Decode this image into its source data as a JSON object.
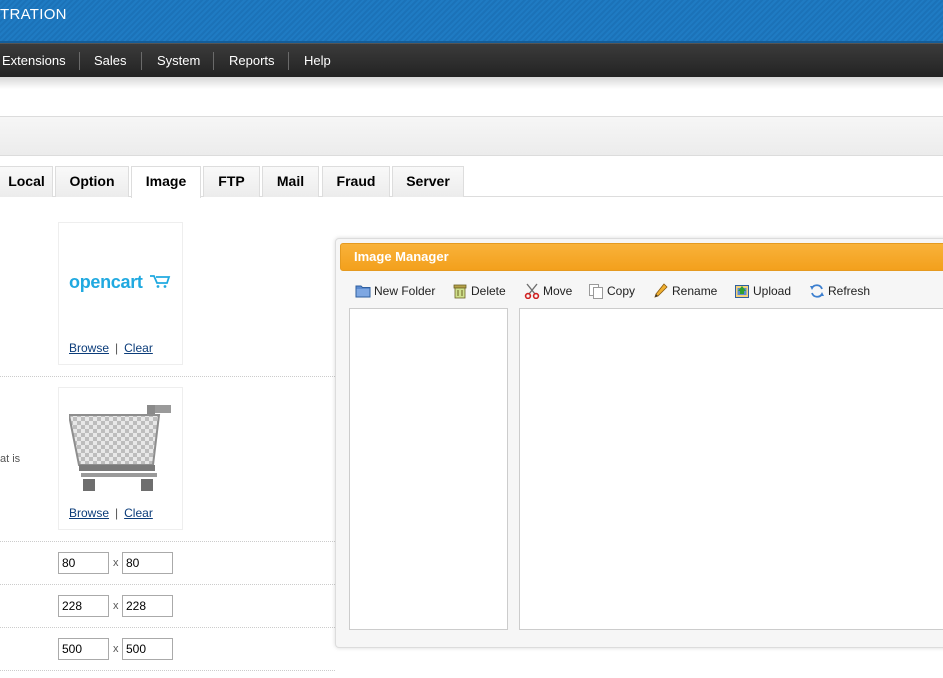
{
  "header": {
    "title": "TRATION",
    "bg_color": "#1f7bc3"
  },
  "menu": {
    "items": [
      {
        "label": "Extensions"
      },
      {
        "label": "Sales"
      },
      {
        "label": "System"
      },
      {
        "label": "Reports"
      },
      {
        "label": "Help"
      }
    ]
  },
  "tabs": [
    {
      "label": "Local",
      "active": false
    },
    {
      "label": "Option",
      "active": false
    },
    {
      "label": "Image",
      "active": true
    },
    {
      "label": "FTP",
      "active": false
    },
    {
      "label": "Mail",
      "active": false
    },
    {
      "label": "Fraud",
      "active": false
    },
    {
      "label": "Server",
      "active": false
    }
  ],
  "form": {
    "logo_field": {
      "logo_text": "opencart",
      "browse": "Browse",
      "separator": "|",
      "clear": "Clear"
    },
    "icon_field": {
      "side_text": "at is",
      "browse": "Browse",
      "separator": "|",
      "clear": "Clear"
    },
    "dimensions": [
      {
        "width": "80",
        "height": "80",
        "x": "x"
      },
      {
        "width": "228",
        "height": "228",
        "x": "x"
      },
      {
        "width": "500",
        "height": "500",
        "x": "x"
      }
    ]
  },
  "image_manager": {
    "title": "Image Manager",
    "accent_color": "#f3a01c",
    "toolbar": [
      {
        "label": "New Folder",
        "icon": "folder-icon"
      },
      {
        "label": "Delete",
        "icon": "trash-icon"
      },
      {
        "label": "Move",
        "icon": "scissors-icon"
      },
      {
        "label": "Copy",
        "icon": "copy-icon"
      },
      {
        "label": "Rename",
        "icon": "pencil-icon"
      },
      {
        "label": "Upload",
        "icon": "upload-icon"
      },
      {
        "label": "Refresh",
        "icon": "refresh-icon"
      }
    ]
  }
}
